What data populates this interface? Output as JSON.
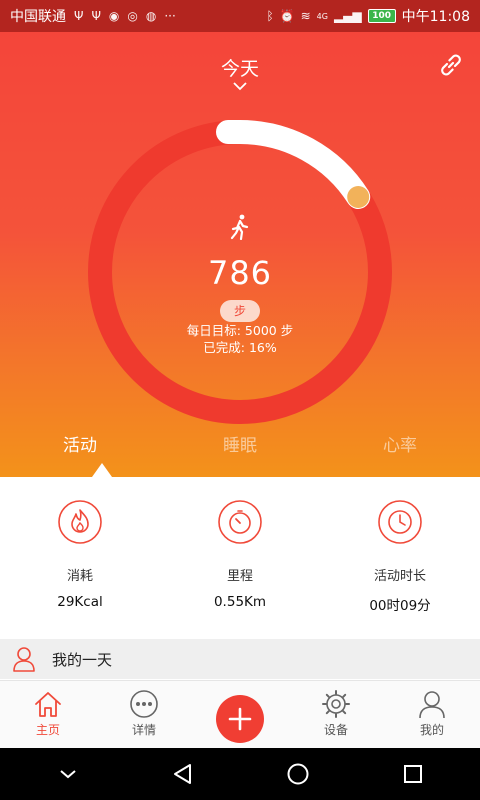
{
  "status_bar": {
    "carrier": "中国联通",
    "icons_left": [
      "usb-icon",
      "usb-icon",
      "app-notification-icon",
      "app-notification-icon",
      "weibo-icon"
    ],
    "more": "···",
    "network": "4G",
    "battery": "100",
    "time": "中午11:08"
  },
  "header": {
    "date_label": "今天"
  },
  "ring": {
    "steps": "786",
    "unit": "步",
    "goal_text": "每日目标: 5000 步",
    "completed_text": "已完成: 16%",
    "progress": 0.16
  },
  "tabs": [
    {
      "label": "活动",
      "active": true
    },
    {
      "label": "睡眠",
      "active": false
    },
    {
      "label": "心率",
      "active": false
    }
  ],
  "stats": [
    {
      "label": "消耗",
      "value": "29Kcal",
      "icon": "flame-icon"
    },
    {
      "label": "里程",
      "value": "0.55Km",
      "icon": "gauge-icon"
    },
    {
      "label": "活动时长",
      "value": "00时09分",
      "icon": "clock-icon"
    }
  ],
  "my_day": {
    "label": "我的一天"
  },
  "bottom_nav": [
    {
      "label": "主页",
      "icon": "home-icon",
      "active": true
    },
    {
      "label": "详情",
      "icon": "more-dots-icon",
      "active": false
    },
    {
      "label": "",
      "icon": "plus-icon",
      "active": false
    },
    {
      "label": "设备",
      "icon": "device-icon",
      "active": false
    },
    {
      "label": "我的",
      "icon": "profile-icon",
      "active": false
    }
  ],
  "colors": {
    "accent": "#f03e33",
    "status_bar": "#b3251f",
    "ring_track": "#ef3a2e",
    "ring_progress": "#ffffff",
    "ring_knob": "#f2b25a"
  }
}
